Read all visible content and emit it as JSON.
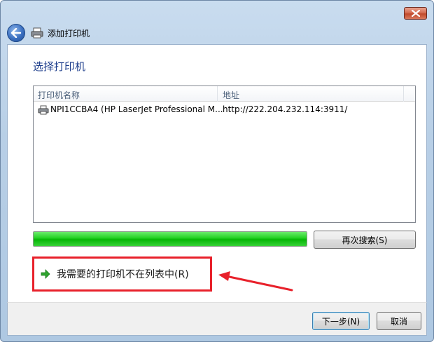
{
  "window": {
    "title": "添加打印机",
    "close_icon": "close-icon",
    "back_icon": "back-arrow-icon",
    "title_icon": "printer-icon"
  },
  "page": {
    "heading": "选择打印机"
  },
  "printer_list": {
    "columns": [
      "打印机名称",
      "地址"
    ],
    "rows": [
      {
        "name": "NPI1CCBA4 (HP LaserJet Professional M...",
        "address": "http://222.204.232.114:3911/",
        "icon": "printer-icon"
      }
    ]
  },
  "progress": {
    "value_fraction": 1.0,
    "color": "#16c416"
  },
  "buttons": {
    "search_again": "再次搜索(S)",
    "next": "下一步(N)",
    "cancel": "取消"
  },
  "link": {
    "text": "我需要的打印机不在列表中(R)",
    "icon": "green-arrow-icon"
  },
  "annotation": {
    "highlight_color": "#e8212b"
  }
}
